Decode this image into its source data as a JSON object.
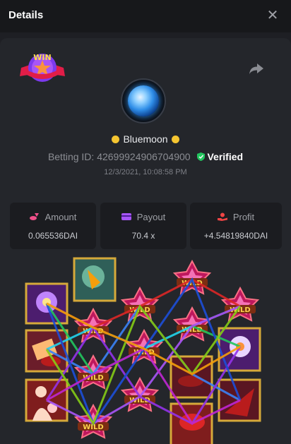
{
  "header": {
    "title": "Details"
  },
  "icons": {
    "close": "close-icon",
    "share": "share-arrow-icon",
    "win": "win-badge-icon",
    "amount": "coins-icon",
    "payout": "wallet-icon",
    "profit": "profit-hand-icon",
    "verified": "shield-check-icon"
  },
  "user": {
    "name": "Bluemoon"
  },
  "bet": {
    "betting_id_label": "Betting ID:",
    "betting_id": "42699924906704900",
    "verified": "Verified",
    "datetime": "12/3/2021, 10:08:58 PM"
  },
  "stats": {
    "amount": {
      "label": "Amount",
      "value": "0.065536DAI"
    },
    "payout": {
      "label": "Payout",
      "value": "70.4 x"
    },
    "profit": {
      "label": "Profit",
      "value": "+4.54819840DAI"
    }
  },
  "colors": {
    "accent_green": "#22c55e",
    "amount_pink": "#f0508a",
    "payout_purple": "#a855f7",
    "profit_red": "#ef4444",
    "symbol_gold": "#d6a93a"
  }
}
